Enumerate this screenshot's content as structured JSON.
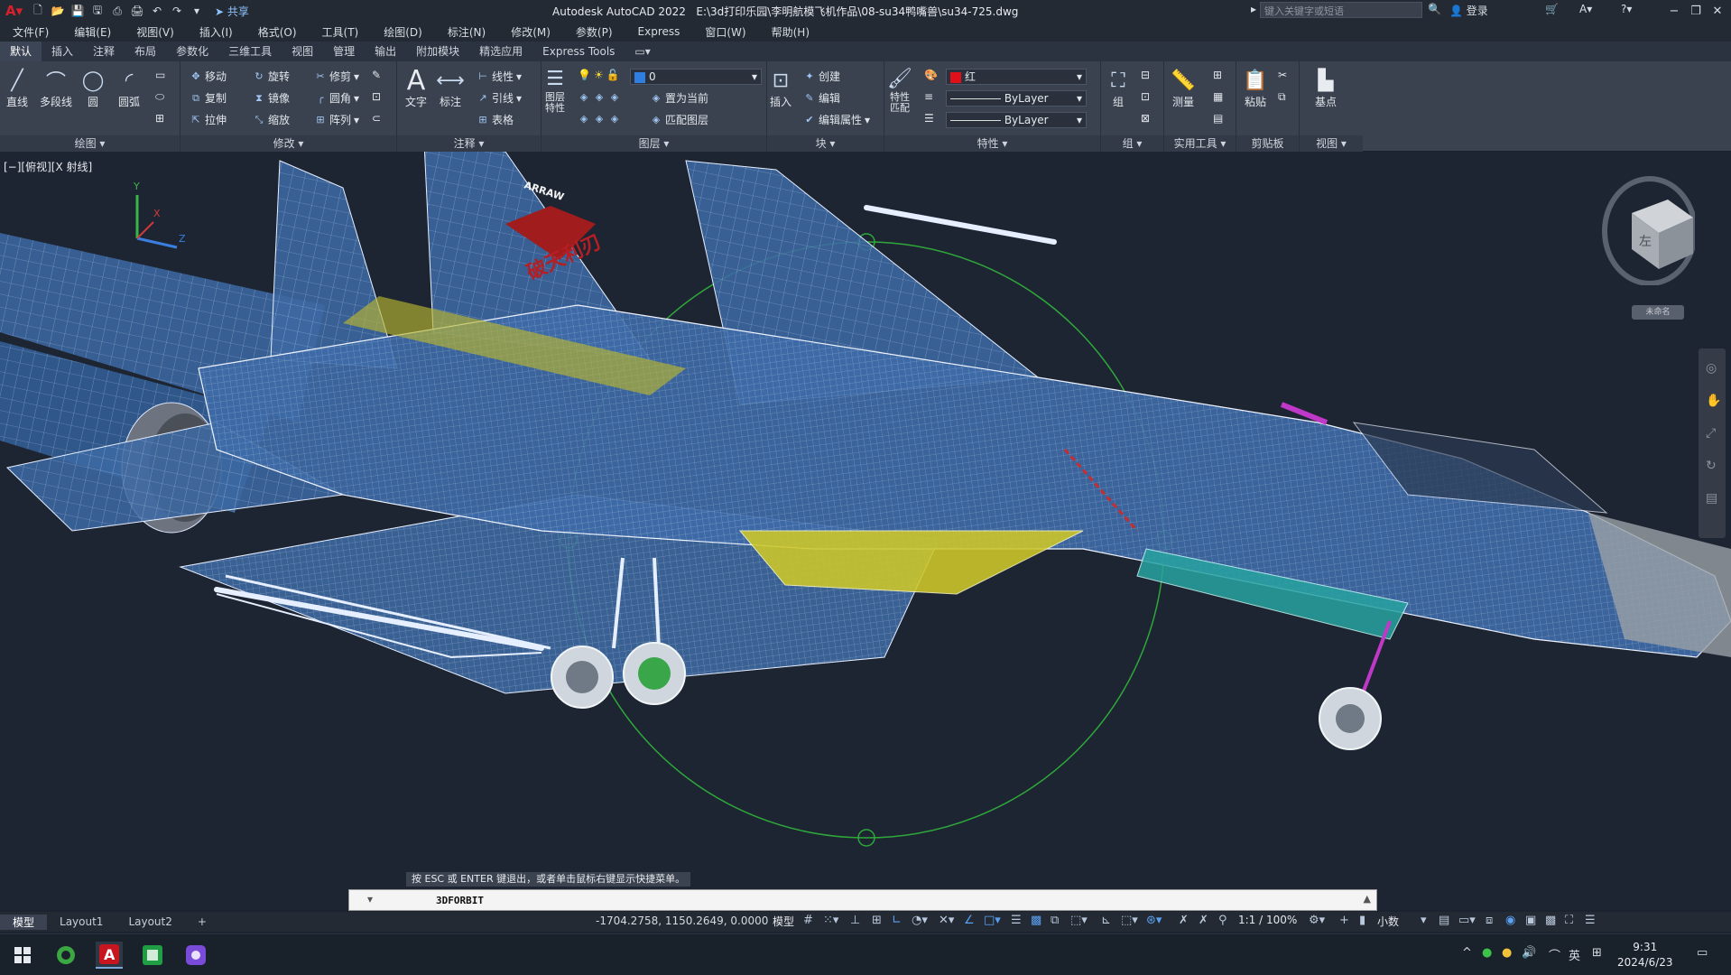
{
  "titlebar": {
    "title": "Autodesk AutoCAD 2022",
    "filepath": "E:\\3d打印乐园\\李明航模飞机作品\\08-su34鸭嘴兽\\su34-725.dwg",
    "share_label": "共享",
    "search_placeholder": "键入关键字或短语",
    "login_label": "登录"
  },
  "menus": [
    "文件(F)",
    "编辑(E)",
    "视图(V)",
    "插入(I)",
    "格式(O)",
    "工具(T)",
    "绘图(D)",
    "标注(N)",
    "修改(M)",
    "参数(P)",
    "Express",
    "窗口(W)",
    "帮助(H)"
  ],
  "tabs": [
    "默认",
    "插入",
    "注释",
    "布局",
    "参数化",
    "三维工具",
    "视图",
    "管理",
    "输出",
    "附加模块",
    "精选应用",
    "Express Tools"
  ],
  "ribbon": {
    "draw": {
      "title": "绘图",
      "line": "直线",
      "polyline": "多段线",
      "circle": "圆",
      "arc": "圆弧"
    },
    "modify": {
      "title": "修改",
      "move": "移动",
      "rotate": "旋转",
      "trim": "修剪",
      "copy": "复制",
      "mirror": "镜像",
      "fillet": "圆角",
      "stretch": "拉伸",
      "scale": "缩放",
      "array": "阵列"
    },
    "annotation": {
      "title": "注释",
      "text": "文字",
      "dimension": "标注",
      "linear": "线性",
      "leader": "引线",
      "table": "表格"
    },
    "layers": {
      "title": "图层",
      "layer_props": "图层\n特性",
      "current_layer": "0",
      "make_current": "置为当前",
      "match_layer": "匹配图层"
    },
    "block": {
      "title": "块",
      "insert": "插入",
      "create": "创建",
      "edit": "编辑",
      "edit_attr": "编辑属性"
    },
    "properties": {
      "title": "特性",
      "match": "特性\n匹配",
      "color": "红",
      "linetype": "ByLayer",
      "lineweight": "ByLayer"
    },
    "groups": {
      "title": "组",
      "group": "组"
    },
    "utilities": {
      "title": "实用工具",
      "measure": "测量"
    },
    "clipboard": {
      "title": "剪贴板",
      "paste": "粘贴"
    },
    "view": {
      "title": "视图",
      "base": "基点"
    }
  },
  "viewport": {
    "label": "[−][俯视][X 射线]",
    "viewcube_face": "左",
    "unnamed_label": "未命名",
    "watermark_text": "破天利刃",
    "badge_text": "ARRAW"
  },
  "command": {
    "tip": "按 ESC 或 ENTER 键退出，或者单击鼠标右键显示快捷菜单。",
    "current": "3DFORBIT"
  },
  "layouts": [
    "模型",
    "Layout1",
    "Layout2"
  ],
  "status": {
    "coords": "-1704.2758, 1150.2649, 0.0000",
    "mode": "模型",
    "scale": "1:1 / 100%",
    "units": "小数"
  },
  "taskbar": {
    "ime": "英",
    "time": "9:31",
    "date": "2024/6/23"
  },
  "colors": {
    "accent": "#d8202a",
    "wire": "#dde8ff",
    "fill_blue": "#3d6aa4",
    "fill_teal": "#27a3a0",
    "fill_yellow": "#cfc828",
    "orbit": "#2ea83a"
  }
}
